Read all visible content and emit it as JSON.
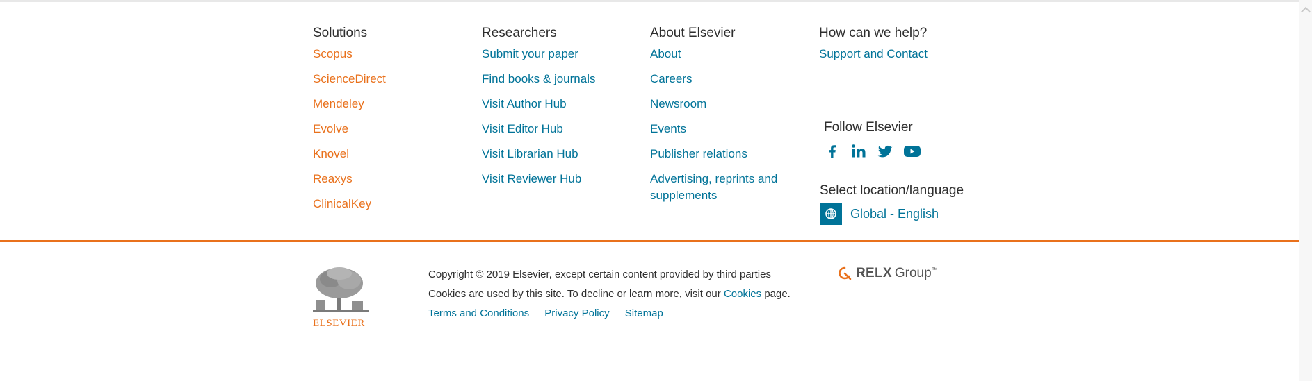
{
  "solutions": {
    "title": "Solutions",
    "items": [
      "Scopus",
      "ScienceDirect",
      "Mendeley",
      "Evolve",
      "Knovel",
      "Reaxys",
      "ClinicalKey"
    ]
  },
  "researchers": {
    "title": "Researchers",
    "items": [
      "Submit your paper",
      "Find books & journals",
      "Visit Author Hub",
      "Visit Editor Hub",
      "Visit Librarian Hub",
      "Visit Reviewer Hub"
    ]
  },
  "about": {
    "title": "About Elsevier",
    "items": [
      "About",
      "Careers",
      "Newsroom",
      "Events",
      "Publisher relations",
      "Advertising, reprints and supplements"
    ]
  },
  "help": {
    "title": "How can we help?",
    "items": [
      "Support and Contact"
    ]
  },
  "follow": {
    "title": "Follow Elsevier",
    "icons": [
      "facebook-icon",
      "linkedin-icon",
      "twitter-icon",
      "youtube-icon"
    ]
  },
  "location": {
    "title": "Select location/language",
    "value": "Global - English"
  },
  "footer": {
    "logo_text": "ELSEVIER",
    "copyright": "Copyright © 2019 Elsevier, except certain content provided by third parties",
    "cookies_prefix": "Cookies are used by this site. To decline or learn more, visit our",
    "cookies_link": "Cookies",
    "cookies_suffix": "page.",
    "links": [
      "Terms and Conditions",
      "Privacy Policy",
      "Sitemap"
    ],
    "relx_word": "RELX",
    "relx_group": "Group",
    "relx_tm": "™"
  },
  "colors": {
    "orange": "#e9711c",
    "blue": "#007398",
    "text": "#2e2e2e"
  }
}
